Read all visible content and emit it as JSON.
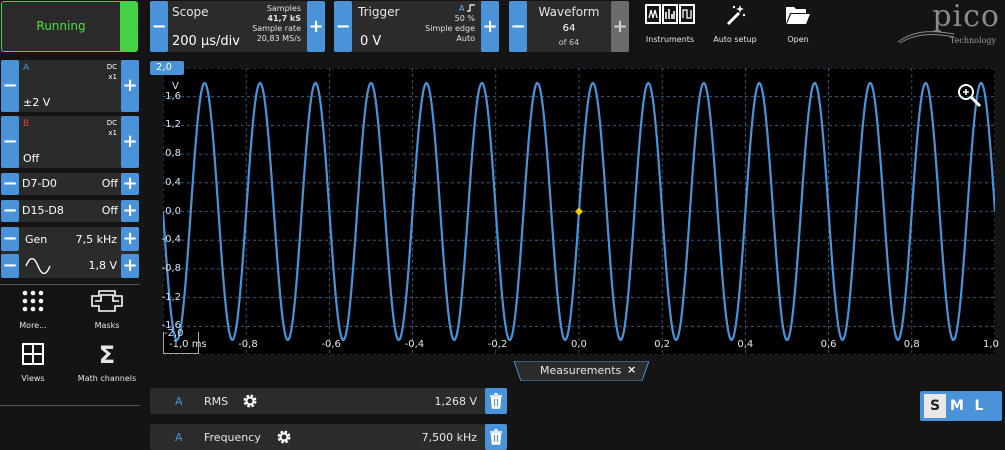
{
  "run": {
    "label": "Running"
  },
  "scope": {
    "title": "Scope",
    "timebase": "200 µs/div",
    "samples_label": "Samples",
    "samples": "41,7 kS",
    "rate_label": "Sample rate",
    "rate": "20,83 MS/s"
  },
  "trigger": {
    "title": "Trigger",
    "level": "0 V",
    "channel": "A",
    "percent": "50 %",
    "type": "Simple edge",
    "mode": "Auto"
  },
  "waveform": {
    "title": "Waveform",
    "current": "64",
    "total": "of 64"
  },
  "tools": {
    "instruments": "Instruments",
    "autosetup": "Auto setup",
    "open": "Open"
  },
  "logo": {
    "name": "pico",
    "sub": "Technology"
  },
  "channels": [
    {
      "name": "A",
      "coupling": "DC",
      "probe": "x1",
      "range": "±2 V",
      "color": "#4a93d8"
    },
    {
      "name": "B",
      "coupling": "DC",
      "probe": "x1",
      "range": "Off",
      "color": "#d24646"
    }
  ],
  "digital": [
    {
      "name": "D7-D0",
      "state": "Off"
    },
    {
      "name": "D15-D8",
      "state": "Off"
    }
  ],
  "gen": {
    "label": "Gen",
    "freq": "7,5 kHz",
    "ampl": "1,8 V"
  },
  "apps": [
    {
      "label": "More...",
      "icon": "grid-dots-icon"
    },
    {
      "label": "Masks",
      "icon": "mask-icon"
    },
    {
      "label": "Views",
      "icon": "views-grid-icon"
    },
    {
      "label": "Math channels",
      "icon": "sigma-icon"
    }
  ],
  "plot": {
    "yunit": "V",
    "ytop": "2,0",
    "ybottom": "-2,0",
    "yticks": [
      "1,6",
      "1,2",
      "0,8",
      "0,4",
      "0,0",
      "-0,4",
      "-0,8",
      "-1,2",
      "-1,6"
    ],
    "xticks": [
      "-1,0 ms",
      "-0,8",
      "-0,6",
      "-0,4",
      "-0,2",
      "0,0",
      "0,2",
      "0,4",
      "0,6",
      "0,8",
      "1,0"
    ],
    "trace_color": "#4a93d8",
    "trigger_color": "#f0d000"
  },
  "chart_data": {
    "type": "line",
    "title": "",
    "xlabel": "ms",
    "ylabel": "V",
    "xlim": [
      -1.0,
      1.0
    ],
    "ylim": [
      -2.0,
      2.0
    ],
    "grid": true,
    "series": [
      {
        "frequency_khz": 7.5,
        "amplitude_v": 1.79,
        "offset_v": 0.0,
        "phase_at_zero": "rising"
      }
    ]
  },
  "measurements_tab": {
    "label": "Measurements"
  },
  "measurements": [
    {
      "channel": "A",
      "name": "RMS",
      "value": "1,268 V"
    },
    {
      "channel": "A",
      "name": "Frequency",
      "value": "7,500 kHz"
    }
  ],
  "size_buttons": [
    {
      "label": "S",
      "selected": true
    },
    {
      "label": "M",
      "selected": false
    },
    {
      "label": "L",
      "selected": false
    }
  ]
}
